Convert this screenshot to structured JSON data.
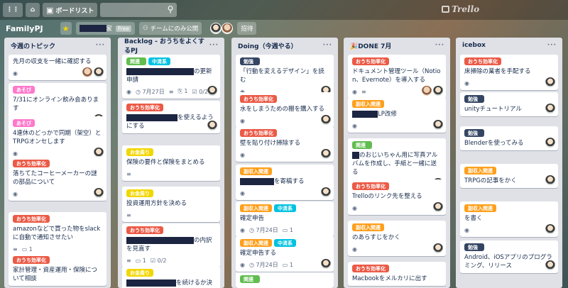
{
  "topbar": {
    "boards_label": "ボードリスト",
    "logo_text": "Trello"
  },
  "board": {
    "title": "FamilyPJ",
    "team_suffix": "家",
    "free_badge": "Free",
    "visibility_label": "チームにのみ公開",
    "invite_label": "招待"
  },
  "colors": {
    "green": "#61bd4f",
    "blue": "#00c2e0",
    "red": "#eb5a46",
    "orange": "#ff9f1a",
    "purple": "#c377e0",
    "pink": "#ff78cb",
    "yellow": "#f2d600",
    "navy": "#344563",
    "redact": "#1c2541"
  },
  "lists": [
    {
      "title": "今週のトピック",
      "cards": [
        {
          "labels": [],
          "text": "先月の収支を一緒に確認する",
          "badges": [
            "eye"
          ],
          "avatars": 2
        },
        {
          "labels": [
            {
              "name": "あそび",
              "color": "pink"
            }
          ],
          "text": "7/31にオンライン飲み会ありま す",
          "badges": [
            "eye"
          ],
          "avatars": 1
        },
        {
          "labels": [
            {
              "name": "あそび",
              "color": "pink"
            }
          ],
          "text": "4連休のどっかで同期（架空）と TRPGオンセします",
          "badges": [
            "eye"
          ],
          "avatars": 1
        },
        {
          "labels": [
            {
              "name": "おうち効率化",
              "color": "red"
            }
          ],
          "text": "落ちてたコーヒーメーカーの謎の部品について",
          "badges": [
            "eye"
          ],
          "avatars": 1
        },
        {
          "labels": [
            {
              "name": "おうち効率化",
              "color": "red"
            }
          ],
          "text": "amazonなどで買った物をslackに自動で通知させたい",
          "badges": [
            "desc",
            "comment:1"
          ],
          "avatars": 0
        },
        {
          "labels": [
            {
              "name": "おうち効率化",
              "color": "red"
            }
          ],
          "text": "家計管理・資産運用・保険について相談",
          "badges": [],
          "avatars": 0
        }
      ]
    },
    {
      "title": "Backlog - おうちをよくするPJ",
      "cards": [
        {
          "labels": [
            {
              "name": "関連",
              "color": "green"
            },
            {
              "name": "中清系",
              "color": "blue"
            }
          ],
          "text": "の更新申請",
          "badges": [
            "eye",
            "date:7月27日",
            "desc",
            "attach:1",
            "check:0/2"
          ],
          "avatars": 1
        },
        {
          "labels": [
            {
              "name": "おうち効率化",
              "color": "red"
            }
          ],
          "text": "を使えるようにする",
          "badges": [],
          "avatars": 1
        },
        {
          "labels": [
            {
              "name": "お金周り",
              "color": "yellow"
            }
          ],
          "text": "保険の要件と保険をまとめる",
          "badges": [
            "desc"
          ],
          "avatars": 0
        },
        {
          "labels": [
            {
              "name": "お金周り",
              "color": "yellow"
            }
          ],
          "text": "投資運用方針を決める",
          "badges": [
            "desc"
          ],
          "avatars": 0
        },
        {
          "labels": [
            {
              "name": "おうち効率化",
              "color": "red"
            }
          ],
          "text": "の内訳を見直す",
          "badges": [
            "desc",
            "comment:1",
            "check:0/2"
          ],
          "avatars": 0
        },
        {
          "labels": [
            {
              "name": "お金周り",
              "color": "yellow"
            }
          ],
          "text": "を続けるか決める",
          "badges": [],
          "avatars": 0
        }
      ]
    },
    {
      "title": "Doing（今週やる）",
      "cards": [
        {
          "labels": [
            {
              "name": "勉強",
              "color": "navy"
            }
          ],
          "text": "「行動を変えるデザイン」を読む",
          "badges": [
            "eye"
          ],
          "avatars": 1
        },
        {
          "labels": [
            {
              "name": "おうち効率化",
              "color": "red"
            }
          ],
          "text": "水をしまうための棚を購入する",
          "badges": [
            "eye"
          ],
          "avatars": 1
        },
        {
          "labels": [
            {
              "name": "おうち効率化",
              "color": "red"
            }
          ],
          "text": "壁を貼り付け掃除する",
          "badges": [
            "eye"
          ],
          "avatars": 1
        },
        {
          "labels": [
            {
              "name": "副収入関連",
              "color": "orange"
            }
          ],
          "text": "を寄稿する",
          "badges": [
            "eye"
          ],
          "avatars": 1
        },
        {
          "labels": [
            {
              "name": "副収入関連",
              "color": "orange"
            },
            {
              "name": "中清系",
              "color": "blue"
            }
          ],
          "text": "確定申告",
          "badges": [
            "eye",
            "date:7月24日",
            "comment:1"
          ],
          "avatars": 0
        },
        {
          "labels": [
            {
              "name": "副収入関連",
              "color": "orange"
            },
            {
              "name": "中清系",
              "color": "blue"
            }
          ],
          "text": "確定申告する",
          "badges": [
            "eye",
            "date:7月24日",
            "comment:1"
          ],
          "avatars": 1
        },
        {
          "labels": [
            {
              "name": "関連",
              "color": "green"
            }
          ],
          "text": "",
          "badges": [],
          "avatars": 0
        }
      ]
    },
    {
      "title": "DONE 7月",
      "cards": [
        {
          "labels": [
            {
              "name": "おうち効率化",
              "color": "red"
            }
          ],
          "text": "ドキュメント管理ツール（Notion、Evernote）を導入する",
          "badges": [
            "eye",
            "desc"
          ],
          "avatars": 2
        },
        {
          "labels": [
            {
              "name": "副収入関連",
              "color": "orange"
            }
          ],
          "text": "LP改修",
          "badges": [
            "eye"
          ],
          "avatars": 1
        },
        {
          "labels": [
            {
              "name": "関連",
              "color": "green"
            }
          ],
          "text": "のおじいちゃん用に写真アルバムを作成し、手紙と一緒に送る",
          "badges": [
            "eye",
            "desc"
          ],
          "avatars": 1
        },
        {
          "labels": [
            {
              "name": "おうち効率化",
              "color": "red"
            }
          ],
          "text": "Trelloのリンク先を整える",
          "badges": [
            "eye"
          ],
          "avatars": 1
        },
        {
          "labels": [
            {
              "name": "副収入関連",
              "color": "orange"
            }
          ],
          "text": "のあらすじをかく",
          "badges": [
            "eye"
          ],
          "avatars": 1
        },
        {
          "labels": [
            {
              "name": "おうち効率化",
              "color": "red"
            }
          ],
          "text": "Macbookをメルカリに出す",
          "badges": [],
          "avatars": 0
        }
      ]
    },
    {
      "title": "icebox",
      "cards": [
        {
          "labels": [
            {
              "name": "おうち効率化",
              "color": "red"
            }
          ],
          "text": "床掃除の業者を手配する",
          "badges": [
            "eye"
          ],
          "avatars": 1
        },
        {
          "labels": [
            {
              "name": "勉強",
              "color": "navy"
            }
          ],
          "text": "unityチュートリアル",
          "badges": [],
          "avatars": 1
        },
        {
          "labels": [
            {
              "name": "勉強",
              "color": "navy"
            }
          ],
          "text": "Blenderを使ってみる",
          "badges": [],
          "avatars": 1
        },
        {
          "labels": [
            {
              "name": "副収入関連",
              "color": "orange"
            }
          ],
          "text": "TRPGの記事をかく",
          "badges": [],
          "avatars": 1
        },
        {
          "labels": [
            {
              "name": "副収入関連",
              "color": "orange"
            }
          ],
          "text": "を書く",
          "badges": [
            "eye"
          ],
          "avatars": 1
        },
        {
          "labels": [
            {
              "name": "勉強",
              "color": "navy"
            }
          ],
          "text": "Android、iOSアプリのプログラミング、リリース",
          "badges": [],
          "avatars": 1
        }
      ]
    }
  ]
}
